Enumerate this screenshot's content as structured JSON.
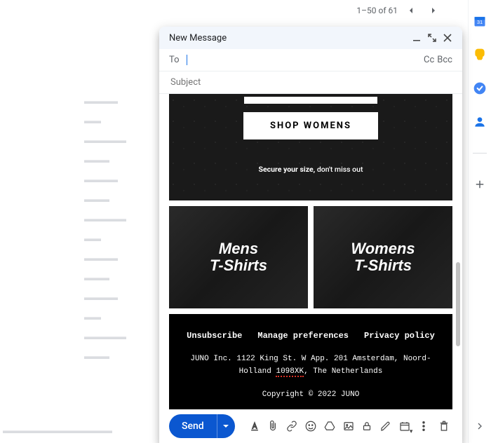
{
  "pagination": {
    "range": "1–50 of 61"
  },
  "compose": {
    "title": "New Message",
    "to_label": "To",
    "cc_label": "Cc",
    "bcc_label": "Bcc",
    "subject_placeholder": "Subject",
    "send_label": "Send"
  },
  "email": {
    "shop_womens": "SHOP WOMENS",
    "secure_pre": "Secure your size,",
    "secure_post": " don't miss out",
    "tile_mens_l1": "Mens",
    "tile_mens_l2": "T-Shirts",
    "tile_womens_l1": "Womens",
    "tile_womens_l2": "T-Shirts",
    "footer": {
      "unsubscribe": "Unsubscribe",
      "manage": "Manage preferences",
      "privacy": "Privacy policy",
      "addr1": "JUNO Inc. 1122 King St. W App. 201 Amsterdam, Noord-Holland ",
      "addr_zip": "1098XK",
      "addr2": ", The Netherlands",
      "copyright": "Copyright © 2022 JUNO"
    }
  }
}
